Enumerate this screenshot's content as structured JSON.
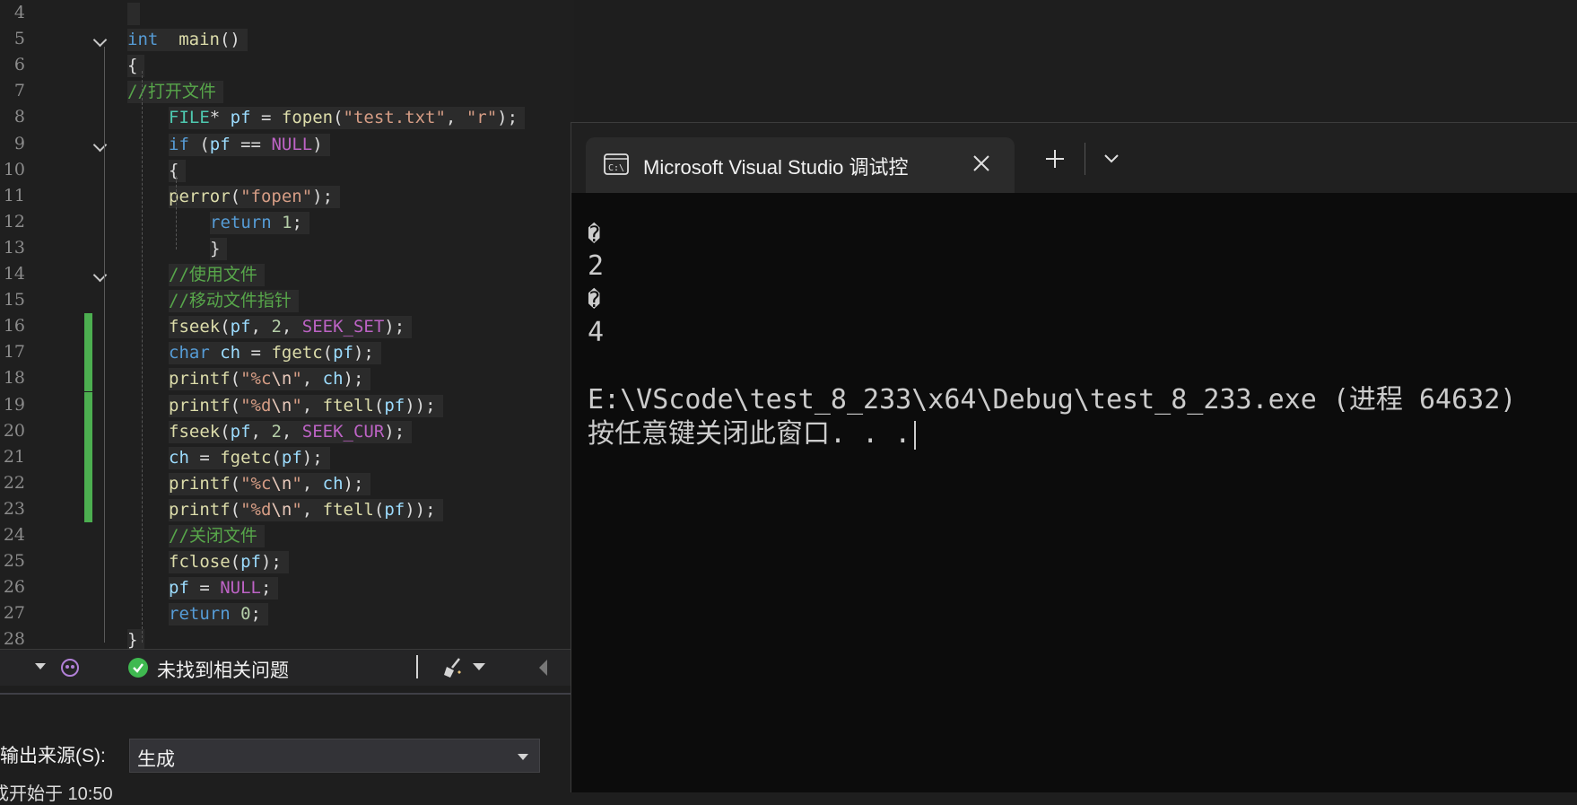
{
  "editor": {
    "lines": [
      {
        "n": "4"
      },
      {
        "n": "5",
        "t": [
          [
            "kw",
            "int"
          ],
          [
            "",
            "  "
          ],
          [
            "fn",
            "main"
          ],
          [
            "",
            "()"
          ]
        ]
      },
      {
        "n": "6",
        "t": [
          [
            "",
            "{"
          ]
        ]
      },
      {
        "n": "7",
        "t": [
          [
            "cm",
            "//打开文件"
          ]
        ]
      },
      {
        "n": "8",
        "t": [
          [
            "ty",
            "FILE"
          ],
          [
            "",
            "* "
          ],
          [
            "var",
            "pf"
          ],
          [
            "",
            " = "
          ],
          [
            "fn",
            "fopen"
          ],
          [
            "",
            "("
          ],
          [
            "str",
            "\"test.txt\""
          ],
          [
            "",
            ", "
          ],
          [
            "str",
            "\"r\""
          ],
          [
            "",
            ");"
          ]
        ]
      },
      {
        "n": "9",
        "t": [
          [
            "kw",
            "if"
          ],
          [
            "",
            " ("
          ],
          [
            "var",
            "pf"
          ],
          [
            "",
            " == "
          ],
          [
            "mac",
            "NULL"
          ],
          [
            "",
            ")"
          ]
        ]
      },
      {
        "n": "10",
        "t": [
          [
            "",
            "{"
          ]
        ]
      },
      {
        "n": "11",
        "t": [
          [
            "fn",
            "perror"
          ],
          [
            "",
            "("
          ],
          [
            "str",
            "\"fopen\""
          ],
          [
            "",
            ");"
          ]
        ]
      },
      {
        "n": "12",
        "t": [
          [
            "kw",
            "return"
          ],
          [
            "",
            " "
          ],
          [
            "num",
            "1"
          ],
          [
            "",
            ";"
          ]
        ]
      },
      {
        "n": "13",
        "t": [
          [
            "",
            "}"
          ]
        ]
      },
      {
        "n": "14",
        "t": [
          [
            "cm",
            "//使用文件"
          ]
        ]
      },
      {
        "n": "15",
        "t": [
          [
            "cm",
            "//移动文件指针"
          ]
        ]
      },
      {
        "n": "16",
        "t": [
          [
            "fn",
            "fseek"
          ],
          [
            "",
            "("
          ],
          [
            "var",
            "pf"
          ],
          [
            "",
            ", "
          ],
          [
            "num",
            "2"
          ],
          [
            "",
            ", "
          ],
          [
            "mac",
            "SEEK_SET"
          ],
          [
            "",
            ");"
          ]
        ]
      },
      {
        "n": "17",
        "t": [
          [
            "kw",
            "char"
          ],
          [
            "",
            " "
          ],
          [
            "var",
            "ch"
          ],
          [
            "",
            " = "
          ],
          [
            "fn",
            "fgetc"
          ],
          [
            "",
            "("
          ],
          [
            "var",
            "pf"
          ],
          [
            "",
            ");"
          ]
        ]
      },
      {
        "n": "18",
        "t": [
          [
            "fn",
            "printf"
          ],
          [
            "",
            "("
          ],
          [
            "str",
            "\"%c"
          ],
          [
            "esc",
            "\\n"
          ],
          [
            "str",
            "\""
          ],
          [
            "",
            ", "
          ],
          [
            "var",
            "ch"
          ],
          [
            "",
            ");"
          ]
        ]
      },
      {
        "n": "19",
        "t": [
          [
            "fn",
            "printf"
          ],
          [
            "",
            "("
          ],
          [
            "str",
            "\"%d"
          ],
          [
            "esc",
            "\\n"
          ],
          [
            "str",
            "\""
          ],
          [
            "",
            ", "
          ],
          [
            "fn",
            "ftell"
          ],
          [
            "",
            "("
          ],
          [
            "var",
            "pf"
          ],
          [
            "",
            "));"
          ]
        ]
      },
      {
        "n": "20",
        "t": [
          [
            "fn",
            "fseek"
          ],
          [
            "",
            "("
          ],
          [
            "var",
            "pf"
          ],
          [
            "",
            ", "
          ],
          [
            "num",
            "2"
          ],
          [
            "",
            ", "
          ],
          [
            "mac",
            "SEEK_CUR"
          ],
          [
            "",
            ");"
          ]
        ]
      },
      {
        "n": "21",
        "t": [
          [
            "var",
            "ch"
          ],
          [
            "",
            " = "
          ],
          [
            "fn",
            "fgetc"
          ],
          [
            "",
            "("
          ],
          [
            "var",
            "pf"
          ],
          [
            "",
            ");"
          ]
        ]
      },
      {
        "n": "22",
        "t": [
          [
            "fn",
            "printf"
          ],
          [
            "",
            "("
          ],
          [
            "str",
            "\"%c"
          ],
          [
            "esc",
            "\\n"
          ],
          [
            "str",
            "\""
          ],
          [
            "",
            ", "
          ],
          [
            "var",
            "ch"
          ],
          [
            "",
            ");"
          ]
        ]
      },
      {
        "n": "23",
        "t": [
          [
            "fn",
            "printf"
          ],
          [
            "",
            "("
          ],
          [
            "str",
            "\"%d"
          ],
          [
            "esc",
            "\\n"
          ],
          [
            "str",
            "\""
          ],
          [
            "",
            ", "
          ],
          [
            "fn",
            "ftell"
          ],
          [
            "",
            "("
          ],
          [
            "var",
            "pf"
          ],
          [
            "",
            "));"
          ]
        ]
      },
      {
        "n": "24",
        "t": [
          [
            "cm",
            "//关闭文件"
          ]
        ]
      },
      {
        "n": "25",
        "t": [
          [
            "fn",
            "fclose"
          ],
          [
            "",
            "("
          ],
          [
            "var",
            "pf"
          ],
          [
            "",
            ");"
          ]
        ]
      },
      {
        "n": "26",
        "t": [
          [
            "var",
            "pf"
          ],
          [
            "",
            " = "
          ],
          [
            "mac",
            "NULL"
          ],
          [
            "",
            ";"
          ]
        ]
      },
      {
        "n": "27",
        "t": [
          [
            "kw",
            "return"
          ],
          [
            "",
            " "
          ],
          [
            "num",
            "0"
          ],
          [
            "",
            ";"
          ]
        ]
      },
      {
        "n": "28",
        "t": [
          [
            "",
            "}"
          ]
        ]
      }
    ]
  },
  "status": {
    "issues_text": "未找到相关问题",
    "issues_icon": "check-circle-icon",
    "copilot_icon": "copilot-icon",
    "cleanup_icon": "broom-icon"
  },
  "output": {
    "source_label": "输出来源(S):",
    "source_value": "生成",
    "partial_line": "成开始于 10:50"
  },
  "terminal": {
    "tab_title": "Microsoft Visual Studio 调试控",
    "tab_icon": "terminal-icon",
    "lines": [
      "�",
      "2",
      "�",
      "4",
      "",
      "E:\\VScode\\test_8_233\\x64\\Debug\\test_8_233.exe (进程 64632)",
      "按任意键关闭此窗口. . ."
    ]
  },
  "colors": {
    "change_bar": "#4caf50",
    "comment": "#57a64a",
    "keyword": "#569cd6",
    "string": "#d69d85",
    "function": "#dcdcaa",
    "macro": "#bd63c5"
  }
}
